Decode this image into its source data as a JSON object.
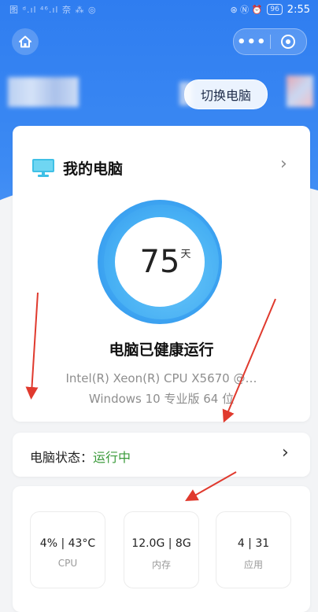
{
  "status_bar": {
    "left_text": "图 ᵈ.ıl ⁴⁶.ıl 奈 ⁂ ◎",
    "right_icons": "⊛ Ⓝ ⏰",
    "battery": "96",
    "time": "2:55"
  },
  "header": {
    "home_icon": "home-icon",
    "more_label": "•••",
    "switch_button": "切换电脑"
  },
  "main_card": {
    "title": "我的电脑",
    "days": "75",
    "days_unit": "天",
    "health_text": "电脑已健康运行",
    "cpu": "Intel(R) Xeon(R) CPU X5670 @…",
    "os": "Windows 10 专业版 64 位"
  },
  "status_card": {
    "label": "电脑状态：",
    "value": "运行中"
  },
  "metrics": [
    {
      "value": "4% | 43°C",
      "label": "CPU"
    },
    {
      "value": "12.0G | 8G",
      "label": "内存"
    },
    {
      "value": "4 | 31",
      "label": "应用"
    }
  ],
  "colors": {
    "header_blue": "#2f7df0",
    "ring_blue": "#3fa7f2",
    "status_green": "#3a9a3a",
    "arrow_red": "#e03a2e"
  }
}
